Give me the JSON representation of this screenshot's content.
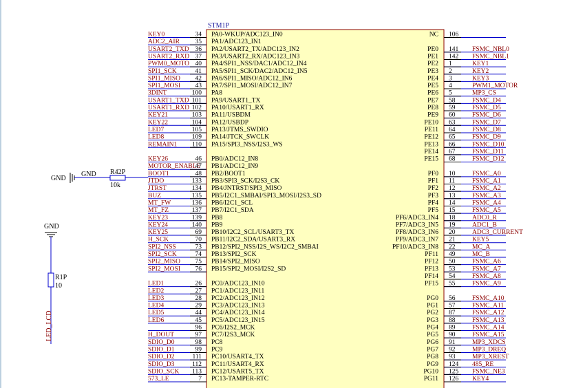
{
  "component": {
    "designator": "STM1P",
    "body_color": "#ffffc0",
    "border_color": "#8b0000",
    "net_color": "#8b0000",
    "pin_color": "#000000",
    "wire_color": "#0000cc",
    "left_pins": [
      {
        "net": "KEY0",
        "num": "34",
        "fn": "PA0-WKUP/ADC123_IN0"
      },
      {
        "net": "ADC2_AIR",
        "num": "35",
        "fn": "PA1/ADC123_IN1"
      },
      {
        "net": "USART2_TXD",
        "num": "36",
        "fn": "PA2/USART2_TX/ADC123_IN2"
      },
      {
        "net": "USART2_RXD",
        "num": "37",
        "fn": "PA3/USART2_RX/ADC123_IN3"
      },
      {
        "net": "PWM0_MOTO",
        "num": "40",
        "fn": "PA4/SPI1_NSS/DAC1/ADC12_IN4"
      },
      {
        "net": "SPI1_SCK",
        "num": "41",
        "fn": "PA5/SPI1_SCK/DAC2/ADC12_IN5"
      },
      {
        "net": "SPI1_MISO",
        "num": "42",
        "fn": "PA6/SPI1_MISO/ADC12_IN6"
      },
      {
        "net": "SPI1_MOSI",
        "num": "43",
        "fn": "PA7/SPI1_MOSI/ADC12_IN7"
      },
      {
        "net": "3DINT",
        "num": "100",
        "fn": "PA8"
      },
      {
        "net": "USART1_TXD",
        "num": "101",
        "fn": "PA9/USART1_TX"
      },
      {
        "net": "USART1_RXD",
        "num": "102",
        "fn": "PA10/USART1_RX"
      },
      {
        "net": "KEY21",
        "num": "103",
        "fn": "PA11/USBDM"
      },
      {
        "net": "KEY22",
        "num": "104",
        "fn": "PA12/USBDP"
      },
      {
        "net": "LED7",
        "num": "105",
        "fn": "PA13/JTMS_SWDIO"
      },
      {
        "net": "LED8",
        "num": "109",
        "fn": "PA14/JTCK_SWCLK"
      },
      {
        "net": "REMAIN1",
        "num": "110",
        "fn": "PA15/SPI3_NSS/I2S3_WS"
      },
      {
        "net": "KEY26",
        "num": "46",
        "fn": "PB0/ADC12_IN8"
      },
      {
        "net": "MOTOR_ENABLE",
        "num": "47",
        "fn": "PB1/ADC12_IN9"
      },
      {
        "net": "BOOT1",
        "num": "48",
        "fn": "PB2/BOOT1"
      },
      {
        "net": "JTDO",
        "num": "133",
        "fn": "PB3/SPI3_SCK/I2S3_CK"
      },
      {
        "net": "JTRST",
        "num": "134",
        "fn": "PB4/JNTRST/SPI3_MISO"
      },
      {
        "net": "BUZ",
        "num": "135",
        "fn": "PB5/I2C1_SMBAI/SPI3_MOSI/I2S3_SD"
      },
      {
        "net": "MT_FW",
        "num": "136",
        "fn": "PB6/I2C1_SCL"
      },
      {
        "net": "MT_FZ",
        "num": "137",
        "fn": "PB7/I2C1_SDA"
      },
      {
        "net": "KEY23",
        "num": "139",
        "fn": "PB8"
      },
      {
        "net": "KEY24",
        "num": "140",
        "fn": "PB9"
      },
      {
        "net": "KEY25",
        "num": "69",
        "fn": "PB10/I2C2_SCL/USART3_TX"
      },
      {
        "net": "H_SCK",
        "num": "70",
        "fn": "PB11/I2C2_SDA/USART3_RX"
      },
      {
        "net": "SPI2_NSS",
        "num": "73",
        "fn": "PB12/SPI2_NSS/I2S_WS/I2C2_SMBAI"
      },
      {
        "net": "SPI2_SCK",
        "num": "74",
        "fn": "PB13/SPI2_SCK"
      },
      {
        "net": "SPI2_MISO",
        "num": "75",
        "fn": "PB14/SPI2_MISO"
      },
      {
        "net": "SPI2_MOSI",
        "num": "76",
        "fn": "PB15/SPI2_MOSI/I2S2_SD"
      },
      {
        "net": "LED1",
        "num": "26",
        "fn": "PC0/ADC123_IN10"
      },
      {
        "net": "LED2",
        "num": "27",
        "fn": "PC1/ADC123_IN11"
      },
      {
        "net": "LED3",
        "num": "28",
        "fn": "PC2/ADC123_IN12"
      },
      {
        "net": "LED4",
        "num": "29",
        "fn": "PC3/ADC123_IN13"
      },
      {
        "net": "LED5",
        "num": "44",
        "fn": "PC4/ADC123_IN14"
      },
      {
        "net": "LED6",
        "num": "45",
        "fn": "PC5/ADC123_IN15"
      },
      {
        "net": "",
        "num": "96",
        "fn": "PC6/I2S2_MCK"
      },
      {
        "net": "H_DOUT",
        "num": "97",
        "fn": "PC7/I2S3_MCK"
      },
      {
        "net": "SDIO_D0",
        "num": "98",
        "fn": "PC8"
      },
      {
        "net": "SDIO_D1",
        "num": "99",
        "fn": "PC9"
      },
      {
        "net": "SDIO_D2",
        "num": "111",
        "fn": "PC10/USART4_TX"
      },
      {
        "net": "SDIO_D3",
        "num": "112",
        "fn": "PC11/USART4_RX"
      },
      {
        "net": "SDIO_SCK",
        "num": "113",
        "fn": "PC12/USART5_TX"
      },
      {
        "net": "573_LE",
        "num": "7",
        "fn": "PC13-TAMPER-RTC"
      }
    ],
    "right_pins": [
      {
        "fn": "NC",
        "num": "106",
        "net": ""
      },
      {
        "fn": "PE0",
        "num": "141",
        "net": "FSMC_NBL0"
      },
      {
        "fn": "PE1",
        "num": "142",
        "net": "FSMC_NBL1"
      },
      {
        "fn": "PE2",
        "num": "1",
        "net": "KEY1"
      },
      {
        "fn": "PE3",
        "num": "2",
        "net": "KEY2"
      },
      {
        "fn": "PE4",
        "num": "3",
        "net": "KEY3"
      },
      {
        "fn": "PE5",
        "num": "4",
        "net": "PWM1_MOTOR"
      },
      {
        "fn": "PE6",
        "num": "5",
        "net": "MP3_CS"
      },
      {
        "fn": "PE7",
        "num": "58",
        "net": "FSMC_D4"
      },
      {
        "fn": "PE8",
        "num": "59",
        "net": "FSMC_D5"
      },
      {
        "fn": "PE9",
        "num": "60",
        "net": "FSMC_D6"
      },
      {
        "fn": "PE10",
        "num": "63",
        "net": "FSMC_D7"
      },
      {
        "fn": "PE11",
        "num": "64",
        "net": "FSMC_D8"
      },
      {
        "fn": "PE12",
        "num": "65",
        "net": "FSMC_D9"
      },
      {
        "fn": "PE13",
        "num": "66",
        "net": "FSMC_D10"
      },
      {
        "fn": "PE14",
        "num": "67",
        "net": "FSMC_D11"
      },
      {
        "fn": "PE15",
        "num": "68",
        "net": "FSMC_D12"
      },
      {
        "fn": "PF0",
        "num": "10",
        "net": "FSMC_A0"
      },
      {
        "fn": "PF1",
        "num": "11",
        "net": "FSMC_A1"
      },
      {
        "fn": "PF2",
        "num": "12",
        "net": "FSMC_A2"
      },
      {
        "fn": "PF3",
        "num": "13",
        "net": "FSMC_A3"
      },
      {
        "fn": "PF4",
        "num": "14",
        "net": "FSMC_A4"
      },
      {
        "fn": "PF5",
        "num": "15",
        "net": "FSMC_A5"
      },
      {
        "fn": "PF6/ADC3_IN4",
        "num": "18",
        "net": "ADC0_R"
      },
      {
        "fn": "PF7/ADC3_IN5",
        "num": "19",
        "net": "ADC1_B"
      },
      {
        "fn": "PF8/ADC3_IN6",
        "num": "20",
        "net": "ADC3_CURRENT"
      },
      {
        "fn": "PF9/ADC3_IN7",
        "num": "21",
        "net": "KEY5"
      },
      {
        "fn": "PF10/ADC3_IN8",
        "num": "22",
        "net": "MC_A"
      },
      {
        "fn": "PF11",
        "num": "49",
        "net": "MC_B"
      },
      {
        "fn": "PF12",
        "num": "50",
        "net": "FSMC_A6"
      },
      {
        "fn": "PF13",
        "num": "53",
        "net": "FSMC_A7"
      },
      {
        "fn": "PF14",
        "num": "54",
        "net": "FSMC_A8"
      },
      {
        "fn": "PF15",
        "num": "55",
        "net": "FSMC_A9"
      },
      {
        "fn": "PG0",
        "num": "56",
        "net": "FSMC_A10"
      },
      {
        "fn": "PG1",
        "num": "57",
        "net": "FSMC_A11"
      },
      {
        "fn": "PG2",
        "num": "87",
        "net": "FSMC_A12"
      },
      {
        "fn": "PG3",
        "num": "88",
        "net": "FSMC_A13"
      },
      {
        "fn": "PG4",
        "num": "89",
        "net": "FSMC_A14"
      },
      {
        "fn": "PG5",
        "num": "90",
        "net": "FSMC_A15"
      },
      {
        "fn": "PG6",
        "num": "91",
        "net": "MP3_XDCS"
      },
      {
        "fn": "PG7",
        "num": "92",
        "net": "MP3_DREQ"
      },
      {
        "fn": "PG8",
        "num": "93",
        "net": "MP3_XREST"
      },
      {
        "fn": "PG9",
        "num": "124",
        "net": "485_RE"
      },
      {
        "fn": "PG10",
        "num": "125",
        "net": "FSMC_NE3"
      },
      {
        "fn": "PG11",
        "num": "126",
        "net": "KEY4"
      }
    ]
  },
  "boot_circuit": {
    "gnd_symbol_label": "GND",
    "gnd_net_label": "GND",
    "resistor_designator": "R42P",
    "resistor_value": "10k"
  },
  "led_circuit": {
    "gnd_label": "GND",
    "resistor_designator": "R1P",
    "resistor_value": "10",
    "net_label": "LED_LCD"
  }
}
